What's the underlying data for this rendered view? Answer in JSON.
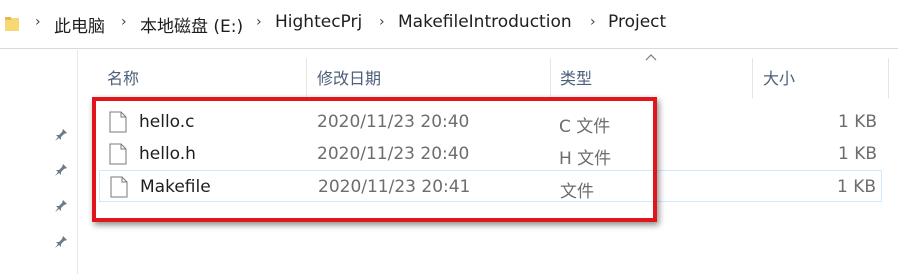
{
  "breadcrumb": {
    "items": [
      "此电脑",
      "本地磁盘 (E:)",
      "HightecPrj",
      "MakefileIntroduction",
      "Project"
    ],
    "separator": "›"
  },
  "columns": {
    "name": "名称",
    "date": "修改日期",
    "type": "类型",
    "size": "大小"
  },
  "files": [
    {
      "name": "hello.c",
      "date": "2020/11/23 20:40",
      "type": "C 文件",
      "size": "1 KB"
    },
    {
      "name": "hello.h",
      "date": "2020/11/23 20:40",
      "type": "H 文件",
      "size": "1 KB"
    },
    {
      "name": "Makefile",
      "date": "2020/11/23 20:41",
      "type": "文件",
      "size": "1 KB"
    }
  ],
  "colors": {
    "highlight": "#e0161c",
    "header_text": "#4c607a",
    "selection_border": "#cde8ff"
  },
  "icons": [
    "folder-icon",
    "pin-icon",
    "file-icon",
    "sort-up-icon"
  ]
}
